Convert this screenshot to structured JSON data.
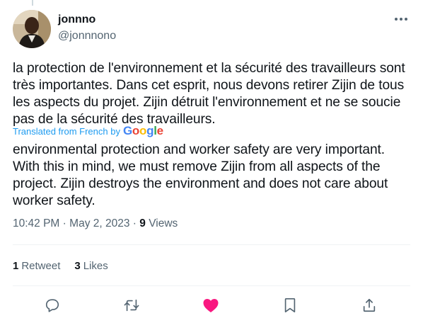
{
  "tweet": {
    "author": {
      "display_name": "jonnno",
      "handle": "@jonnnono",
      "avatar_icon": "profile-photo"
    },
    "original_text": "la protection de l'environnement et la sécurité des travailleurs sont très importantes. Dans cet esprit, nous devons retirer Zijin de tous les aspects du projet. Zijin détruit l'environnement et ne se soucie pas de la sécurité des travailleurs.",
    "translation": {
      "label": "Translated from French by",
      "provider": "Google"
    },
    "translated_text": "environmental protection and worker safety are very important. With this in mind, we must remove Zijin from all aspects of the project. Zijin destroys the environment and does not care about worker safety.",
    "timestamp": {
      "time": "10:42 PM",
      "separator": "·",
      "date": "May 2, 2023",
      "views_count": "9",
      "views_label": "Views"
    },
    "stats": {
      "retweets_count": "1",
      "retweets_label": "Retweet",
      "likes_count": "3",
      "likes_label": "Likes"
    },
    "actions": [
      "reply-icon",
      "retweet-icon",
      "like-icon",
      "bookmark-icon",
      "share-icon"
    ]
  },
  "colors": {
    "text_primary": "#0f1419",
    "text_secondary": "#536471",
    "accent_blue": "#1d9bf0",
    "like_pink": "#f91880",
    "divider": "#eff3f4"
  }
}
